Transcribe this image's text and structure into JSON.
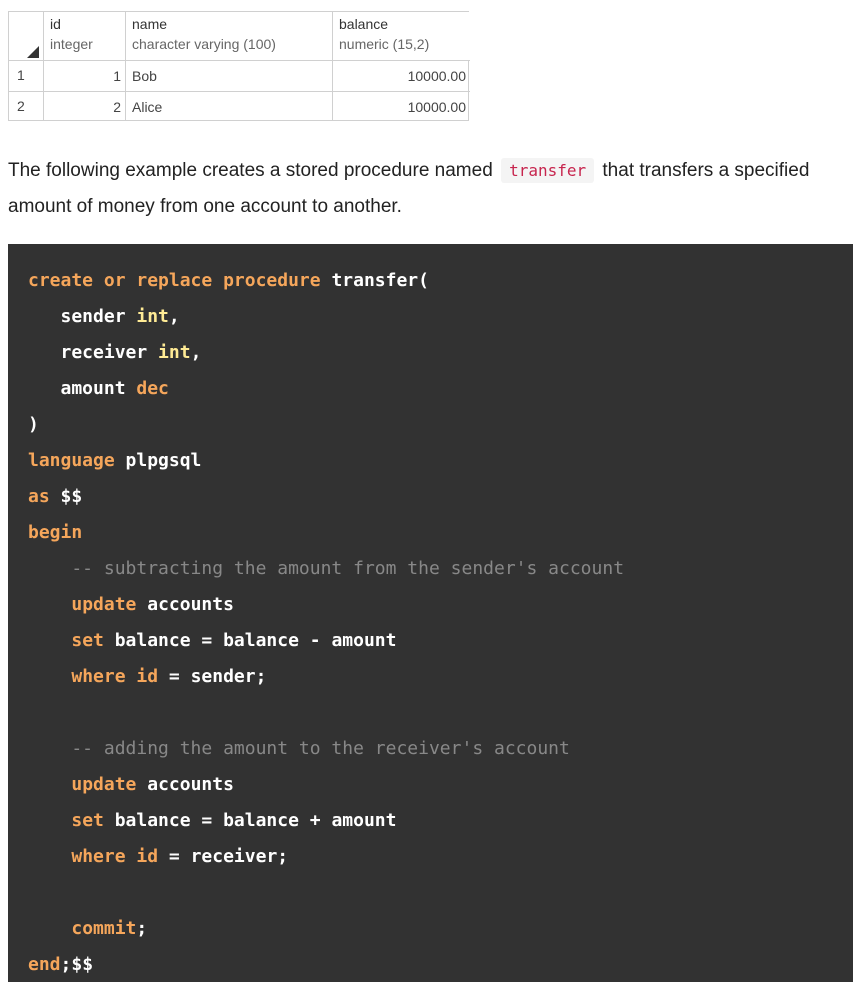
{
  "table": {
    "columns": [
      {
        "name": "id",
        "type": "integer"
      },
      {
        "name": "name",
        "type": "character varying (100)"
      },
      {
        "name": "balance",
        "type": "numeric (15,2)"
      }
    ],
    "rows": [
      {
        "rownum": "1",
        "id": "1",
        "name": "Bob",
        "balance": "10000.00"
      },
      {
        "rownum": "2",
        "id": "2",
        "name": "Alice",
        "balance": "10000.00"
      }
    ]
  },
  "paragraph": {
    "before": "The following example creates a stored procedure named",
    "code": "transfer",
    "after": "that transfers a specified amount of money from one account to another."
  },
  "code": {
    "lines": [
      [
        {
          "t": "create or replace procedure",
          "c": "kw"
        },
        {
          "t": " transfer(",
          "c": "pl"
        }
      ],
      [
        {
          "t": "   sender ",
          "c": "pl"
        },
        {
          "t": "int",
          "c": "ty"
        },
        {
          "t": ",",
          "c": "pl"
        }
      ],
      [
        {
          "t": "   receiver ",
          "c": "pl"
        },
        {
          "t": "int",
          "c": "ty"
        },
        {
          "t": ",",
          "c": "pl"
        }
      ],
      [
        {
          "t": "   amount ",
          "c": "pl"
        },
        {
          "t": "dec",
          "c": "kw"
        }
      ],
      [
        {
          "t": ")",
          "c": "pl"
        }
      ],
      [
        {
          "t": "language",
          "c": "kw"
        },
        {
          "t": " plpgsql",
          "c": "pl"
        }
      ],
      [
        {
          "t": "as",
          "c": "kw"
        },
        {
          "t": " $$",
          "c": "pl"
        }
      ],
      [
        {
          "t": "begin",
          "c": "kw"
        }
      ],
      [
        {
          "t": "    -- subtracting the amount from the sender's account",
          "c": "cm"
        }
      ],
      [
        {
          "t": "    ",
          "c": "pl"
        },
        {
          "t": "update",
          "c": "kw"
        },
        {
          "t": " accounts",
          "c": "pl"
        }
      ],
      [
        {
          "t": "    ",
          "c": "pl"
        },
        {
          "t": "set",
          "c": "kw"
        },
        {
          "t": " balance = balance - amount",
          "c": "pl"
        }
      ],
      [
        {
          "t": "    ",
          "c": "pl"
        },
        {
          "t": "where",
          "c": "kw"
        },
        {
          "t": " ",
          "c": "pl"
        },
        {
          "t": "id",
          "c": "kw"
        },
        {
          "t": " = sender;",
          "c": "pl"
        }
      ],
      [],
      [
        {
          "t": "    -- adding the amount to the receiver's account",
          "c": "cm"
        }
      ],
      [
        {
          "t": "    ",
          "c": "pl"
        },
        {
          "t": "update",
          "c": "kw"
        },
        {
          "t": " accounts",
          "c": "pl"
        }
      ],
      [
        {
          "t": "    ",
          "c": "pl"
        },
        {
          "t": "set",
          "c": "kw"
        },
        {
          "t": " balance = balance + amount",
          "c": "pl"
        }
      ],
      [
        {
          "t": "    ",
          "c": "pl"
        },
        {
          "t": "where",
          "c": "kw"
        },
        {
          "t": " ",
          "c": "pl"
        },
        {
          "t": "id",
          "c": "kw"
        },
        {
          "t": " = receiver;",
          "c": "pl"
        }
      ],
      [],
      [
        {
          "t": "    ",
          "c": "pl"
        },
        {
          "t": "commit",
          "c": "kw"
        },
        {
          "t": ";",
          "c": "pl"
        }
      ],
      [
        {
          "t": "end",
          "c": "kw"
        },
        {
          "t": ";$$",
          "c": "pl"
        }
      ]
    ]
  }
}
